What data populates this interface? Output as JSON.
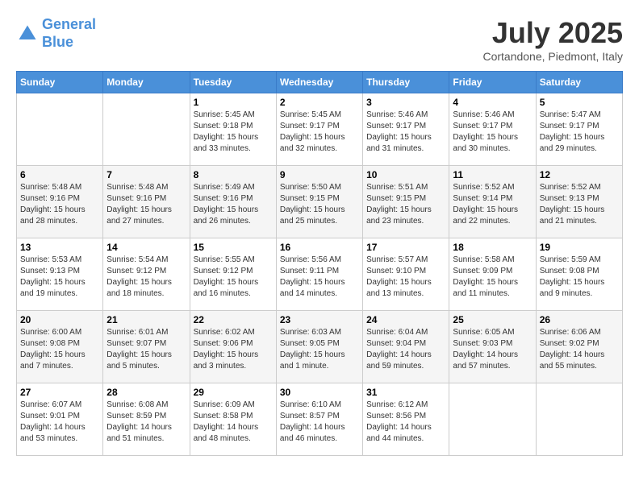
{
  "header": {
    "logo_line1": "General",
    "logo_line2": "Blue",
    "month": "July 2025",
    "location": "Cortandone, Piedmont, Italy"
  },
  "weekdays": [
    "Sunday",
    "Monday",
    "Tuesday",
    "Wednesday",
    "Thursday",
    "Friday",
    "Saturday"
  ],
  "weeks": [
    [
      {
        "day": "",
        "info": ""
      },
      {
        "day": "",
        "info": ""
      },
      {
        "day": "1",
        "info": "Sunrise: 5:45 AM\nSunset: 9:18 PM\nDaylight: 15 hours\nand 33 minutes."
      },
      {
        "day": "2",
        "info": "Sunrise: 5:45 AM\nSunset: 9:17 PM\nDaylight: 15 hours\nand 32 minutes."
      },
      {
        "day": "3",
        "info": "Sunrise: 5:46 AM\nSunset: 9:17 PM\nDaylight: 15 hours\nand 31 minutes."
      },
      {
        "day": "4",
        "info": "Sunrise: 5:46 AM\nSunset: 9:17 PM\nDaylight: 15 hours\nand 30 minutes."
      },
      {
        "day": "5",
        "info": "Sunrise: 5:47 AM\nSunset: 9:17 PM\nDaylight: 15 hours\nand 29 minutes."
      }
    ],
    [
      {
        "day": "6",
        "info": "Sunrise: 5:48 AM\nSunset: 9:16 PM\nDaylight: 15 hours\nand 28 minutes."
      },
      {
        "day": "7",
        "info": "Sunrise: 5:48 AM\nSunset: 9:16 PM\nDaylight: 15 hours\nand 27 minutes."
      },
      {
        "day": "8",
        "info": "Sunrise: 5:49 AM\nSunset: 9:16 PM\nDaylight: 15 hours\nand 26 minutes."
      },
      {
        "day": "9",
        "info": "Sunrise: 5:50 AM\nSunset: 9:15 PM\nDaylight: 15 hours\nand 25 minutes."
      },
      {
        "day": "10",
        "info": "Sunrise: 5:51 AM\nSunset: 9:15 PM\nDaylight: 15 hours\nand 23 minutes."
      },
      {
        "day": "11",
        "info": "Sunrise: 5:52 AM\nSunset: 9:14 PM\nDaylight: 15 hours\nand 22 minutes."
      },
      {
        "day": "12",
        "info": "Sunrise: 5:52 AM\nSunset: 9:13 PM\nDaylight: 15 hours\nand 21 minutes."
      }
    ],
    [
      {
        "day": "13",
        "info": "Sunrise: 5:53 AM\nSunset: 9:13 PM\nDaylight: 15 hours\nand 19 minutes."
      },
      {
        "day": "14",
        "info": "Sunrise: 5:54 AM\nSunset: 9:12 PM\nDaylight: 15 hours\nand 18 minutes."
      },
      {
        "day": "15",
        "info": "Sunrise: 5:55 AM\nSunset: 9:12 PM\nDaylight: 15 hours\nand 16 minutes."
      },
      {
        "day": "16",
        "info": "Sunrise: 5:56 AM\nSunset: 9:11 PM\nDaylight: 15 hours\nand 14 minutes."
      },
      {
        "day": "17",
        "info": "Sunrise: 5:57 AM\nSunset: 9:10 PM\nDaylight: 15 hours\nand 13 minutes."
      },
      {
        "day": "18",
        "info": "Sunrise: 5:58 AM\nSunset: 9:09 PM\nDaylight: 15 hours\nand 11 minutes."
      },
      {
        "day": "19",
        "info": "Sunrise: 5:59 AM\nSunset: 9:08 PM\nDaylight: 15 hours\nand 9 minutes."
      }
    ],
    [
      {
        "day": "20",
        "info": "Sunrise: 6:00 AM\nSunset: 9:08 PM\nDaylight: 15 hours\nand 7 minutes."
      },
      {
        "day": "21",
        "info": "Sunrise: 6:01 AM\nSunset: 9:07 PM\nDaylight: 15 hours\nand 5 minutes."
      },
      {
        "day": "22",
        "info": "Sunrise: 6:02 AM\nSunset: 9:06 PM\nDaylight: 15 hours\nand 3 minutes."
      },
      {
        "day": "23",
        "info": "Sunrise: 6:03 AM\nSunset: 9:05 PM\nDaylight: 15 hours\nand 1 minute."
      },
      {
        "day": "24",
        "info": "Sunrise: 6:04 AM\nSunset: 9:04 PM\nDaylight: 14 hours\nand 59 minutes."
      },
      {
        "day": "25",
        "info": "Sunrise: 6:05 AM\nSunset: 9:03 PM\nDaylight: 14 hours\nand 57 minutes."
      },
      {
        "day": "26",
        "info": "Sunrise: 6:06 AM\nSunset: 9:02 PM\nDaylight: 14 hours\nand 55 minutes."
      }
    ],
    [
      {
        "day": "27",
        "info": "Sunrise: 6:07 AM\nSunset: 9:01 PM\nDaylight: 14 hours\nand 53 minutes."
      },
      {
        "day": "28",
        "info": "Sunrise: 6:08 AM\nSunset: 8:59 PM\nDaylight: 14 hours\nand 51 minutes."
      },
      {
        "day": "29",
        "info": "Sunrise: 6:09 AM\nSunset: 8:58 PM\nDaylight: 14 hours\nand 48 minutes."
      },
      {
        "day": "30",
        "info": "Sunrise: 6:10 AM\nSunset: 8:57 PM\nDaylight: 14 hours\nand 46 minutes."
      },
      {
        "day": "31",
        "info": "Sunrise: 6:12 AM\nSunset: 8:56 PM\nDaylight: 14 hours\nand 44 minutes."
      },
      {
        "day": "",
        "info": ""
      },
      {
        "day": "",
        "info": ""
      }
    ]
  ]
}
